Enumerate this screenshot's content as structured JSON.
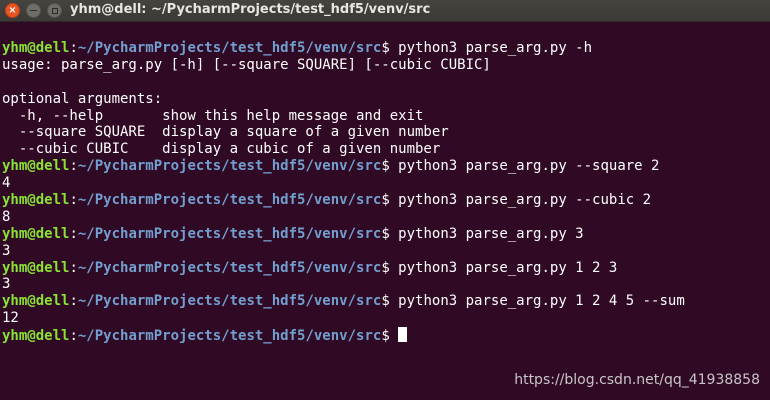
{
  "window": {
    "title": "yhm@dell: ~/PycharmProjects/test_hdf5/venv/src",
    "close_glyph": "×"
  },
  "prompt": {
    "user_host": "yhm@dell",
    "sep": ":",
    "path": "~/PycharmProjects/test_hdf5/venv/src",
    "symbol": "$ "
  },
  "lines": [
    {
      "type": "cmd",
      "text": "python3 parse_arg.py -h"
    },
    {
      "type": "out",
      "text": "usage: parse_arg.py [-h] [--square SQUARE] [--cubic CUBIC]"
    },
    {
      "type": "out",
      "text": ""
    },
    {
      "type": "out",
      "text": "optional arguments:"
    },
    {
      "type": "out",
      "text": "  -h, --help       show this help message and exit"
    },
    {
      "type": "out",
      "text": "  --square SQUARE  display a square of a given number"
    },
    {
      "type": "out",
      "text": "  --cubic CUBIC    display a cubic of a given number"
    },
    {
      "type": "cmd",
      "text": "python3 parse_arg.py --square 2"
    },
    {
      "type": "out",
      "text": "4"
    },
    {
      "type": "cmd",
      "text": "python3 parse_arg.py --cubic 2"
    },
    {
      "type": "out",
      "text": "8"
    },
    {
      "type": "cmd",
      "text": "python3 parse_arg.py 3"
    },
    {
      "type": "out",
      "text": "3"
    },
    {
      "type": "cmd",
      "text": "python3 parse_arg.py 1 2 3"
    },
    {
      "type": "out",
      "text": "3"
    },
    {
      "type": "cmd",
      "text": "python3 parse_arg.py 1 2 4 5 --sum"
    },
    {
      "type": "out",
      "text": "12"
    },
    {
      "type": "cmd",
      "text": "",
      "cursor": true
    }
  ],
  "watermark": "https://blog.csdn.net/qq_41938858",
  "colors": {
    "background": "#300a24",
    "user": "#8ae234",
    "path": "#729fcf",
    "text": "#ffffff",
    "close_button": "#e95420"
  }
}
